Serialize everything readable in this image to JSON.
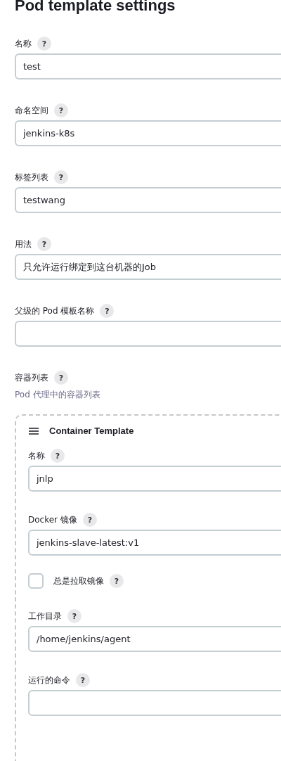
{
  "title": "Pod template settings",
  "fields": [
    {
      "label": "名称",
      "help": "?",
      "value": "test"
    },
    {
      "label": "命名空间",
      "help": "?",
      "value": "jenkins-k8s"
    },
    {
      "label": "标签列表",
      "help": "?",
      "value": "testwang"
    },
    {
      "label": "用法",
      "help": "?",
      "value": "只允许运行绑定到这台机器的Job"
    },
    {
      "label": "父级的 Pod 模板名称",
      "help": "?"
    }
  ],
  "containers": {
    "label": "容器列表",
    "help": "?",
    "description": "Pod 代理中的容器列表",
    "template": {
      "title": "Container Template",
      "items": [
        {
          "kind": "text",
          "label": "名称",
          "help": "?",
          "value": "jnlp"
        },
        {
          "kind": "text",
          "label": "Docker 镜像",
          "help": "?",
          "value": "jenkins-slave-latest:v1"
        },
        {
          "kind": "checkbox",
          "label": "总是拉取镜像",
          "help": "?",
          "checked": false
        },
        {
          "kind": "text",
          "label": "工作目录",
          "help": "?",
          "value": "/home/jenkins/agent"
        },
        {
          "kind": "text",
          "label": "运行的命令",
          "help": "?"
        }
      ]
    }
  }
}
